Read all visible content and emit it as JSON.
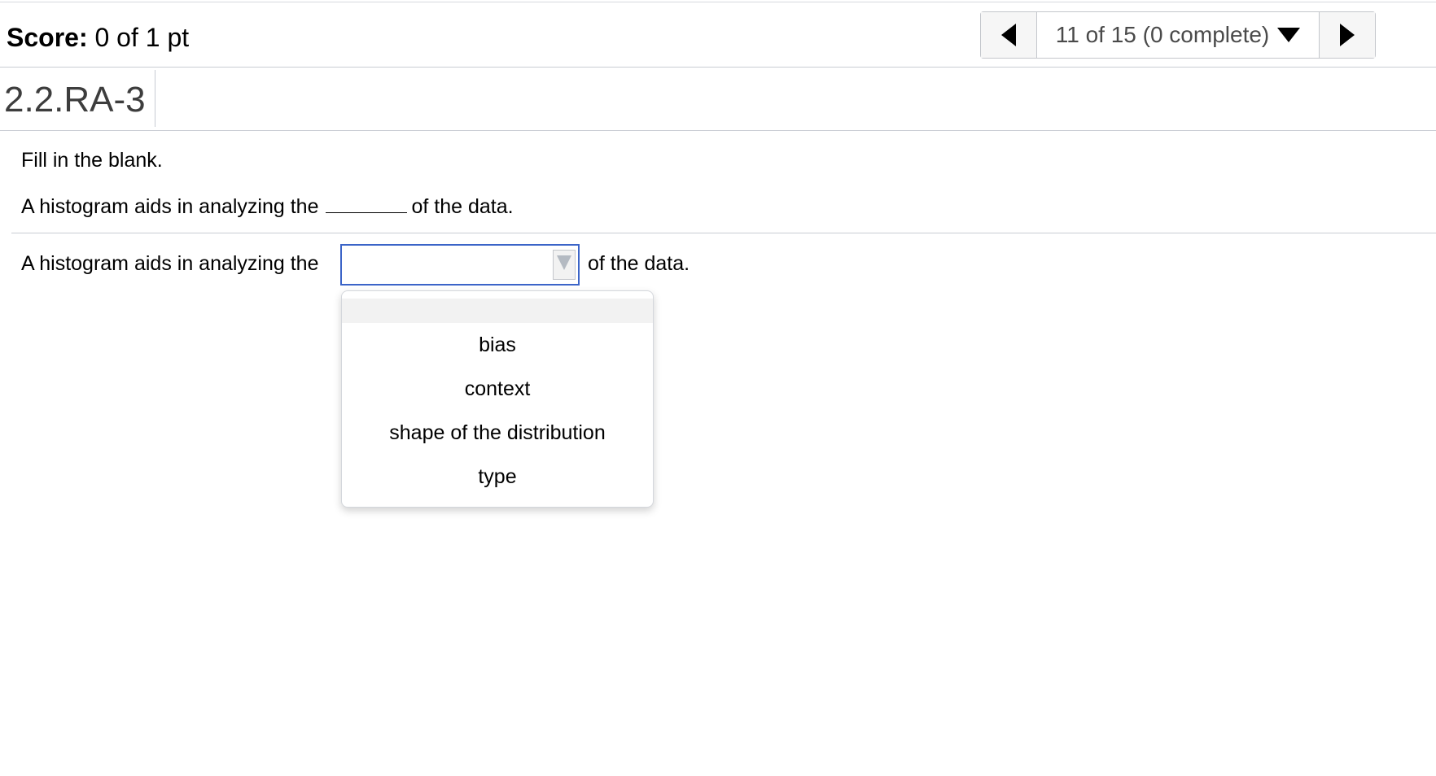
{
  "header": {
    "score_label": "Score:",
    "score_value": "0 of 1 pt",
    "nav_position": "11 of 15 (0 complete)"
  },
  "question": {
    "id": "2.2.RA-3",
    "instruction": "Fill in the blank.",
    "sentence_prefix": "A histogram aids in analyzing the",
    "sentence_suffix": "of the data."
  },
  "answer": {
    "selected_value": "",
    "options": [
      "",
      "bias",
      "context",
      "shape of the distribution",
      "type"
    ]
  },
  "icons": {
    "prev": "left-triangle-icon",
    "next": "right-triangle-icon",
    "nav_menu": "down-triangle-icon",
    "select_arrow": "down-triangle-icon"
  },
  "colors": {
    "select_focus_border": "#3b64c8"
  }
}
